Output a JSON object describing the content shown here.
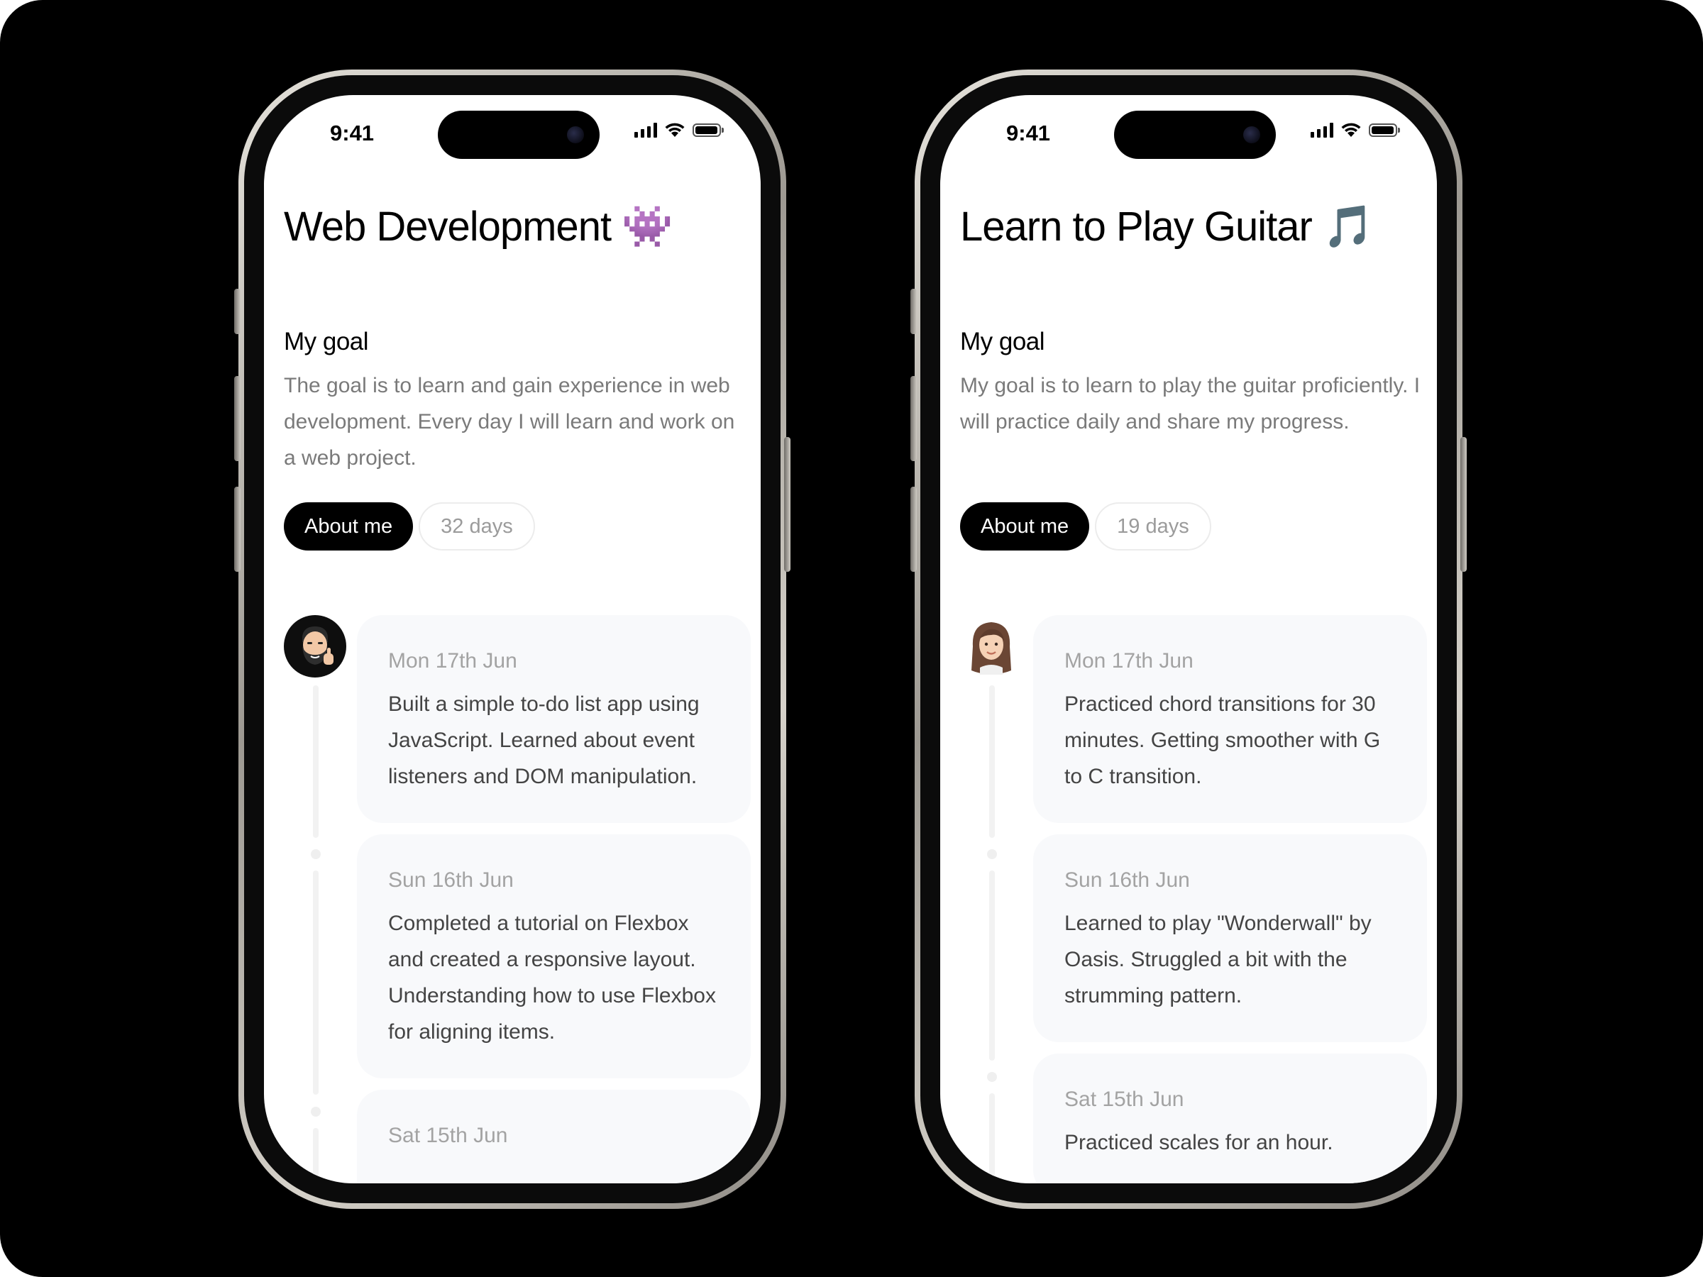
{
  "phones": [
    {
      "status_time": "9:41",
      "title": "Web Development",
      "title_emoji": "👾",
      "goal_heading": "My goal",
      "goal_text": "The goal is to learn and gain experience in web development. Every day I will learn and work on a web project.",
      "about_label": "About me",
      "days_label": "32 days",
      "entries": [
        {
          "date": "Mon 17th Jun",
          "text": "Built a simple to-do list app using JavaScript. Learned about event listeners and DOM manipulation."
        },
        {
          "date": "Sun 16th Jun",
          "text": "Completed a tutorial on Flexbox and created a responsive layout. Understanding how to use Flexbox for aligning items."
        },
        {
          "date": "Sat 15th Jun",
          "text": ""
        }
      ]
    },
    {
      "status_time": "9:41",
      "title": "Learn to Play Guitar",
      "title_emoji": "🎵",
      "goal_heading": "My goal",
      "goal_text": "My goal is to learn to play the guitar proficiently. I will practice daily and share my progress.",
      "about_label": "About me",
      "days_label": "19 days",
      "entries": [
        {
          "date": "Mon 17th Jun",
          "text": "Practiced chord transitions for 30 minutes. Getting smoother with G to C transition."
        },
        {
          "date": "Sun 16th Jun",
          "text": "Learned to play \"Wonderwall\" by Oasis. Struggled a bit with the strumming pattern."
        },
        {
          "date": "Sat 15th Jun",
          "text": "Practiced scales for an hour."
        }
      ]
    }
  ]
}
